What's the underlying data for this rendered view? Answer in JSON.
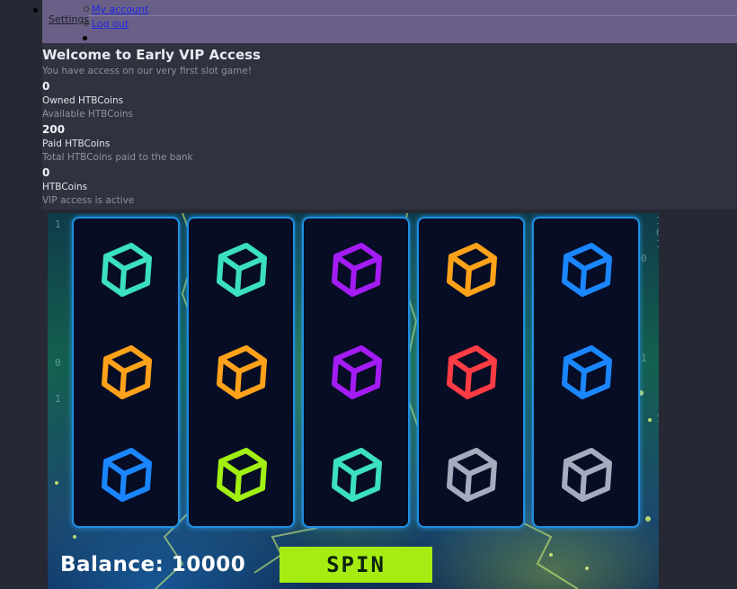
{
  "nav": {
    "settings_label": "Settings",
    "my_account_label": "My account",
    "logout_label": "Log out"
  },
  "welcome": {
    "title": "Welcome to Early VIP Access",
    "subtitle": "You have access on our very first slot game!"
  },
  "stats": [
    {
      "value": "0",
      "label": "Owned HTBCoins",
      "description": "Available HTBCoins"
    },
    {
      "value": "200",
      "label": "Paid HTBCoins",
      "description": "Total HTBCoins paid to the bank"
    },
    {
      "value": "0",
      "label": "HTBCoins",
      "description": "VIP access is active"
    }
  ],
  "game": {
    "balance_label": "Balance: 10000",
    "spin_label": "SPIN",
    "background_codes": [
      "1",
      "0",
      "1",
      "1",
      "0",
      "1",
      "0",
      "1",
      "1"
    ],
    "reels": [
      [
        "teal-cube-icon",
        "orange-cube-icon",
        "blue-cube-icon"
      ],
      [
        "teal-cube-icon",
        "orange-cube-icon",
        "lime-cube-icon"
      ],
      [
        "purple-cube-icon",
        "purple-cube-icon",
        "teal-cube-icon"
      ],
      [
        "orange-cube-icon",
        "red-cube-icon",
        "gray-cube-icon"
      ],
      [
        "blue-cube-icon",
        "blue-cube-icon",
        "gray-cube-icon"
      ]
    ],
    "colors": {
      "teal": "#3be0c0",
      "orange": "#ffa21a",
      "blue": "#1a86ff",
      "lime": "#a2f012",
      "purple": "#a41cf4",
      "red": "#ff3b44",
      "gray": "#a6abbe",
      "spin_button": "#a6ec12",
      "reel_border": "#1f8fe0"
    }
  }
}
